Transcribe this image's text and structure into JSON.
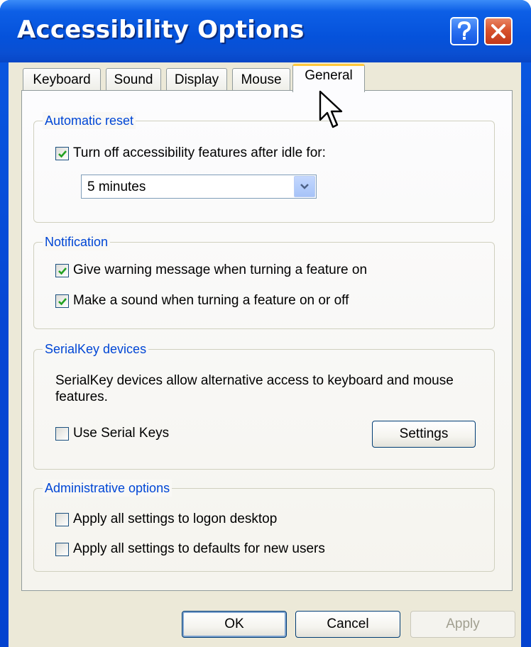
{
  "window": {
    "title": "Accessibility Options",
    "help_icon": "question-mark-icon",
    "close_icon": "close-x-icon"
  },
  "tabs": [
    {
      "label": "Keyboard",
      "active": false
    },
    {
      "label": "Sound",
      "active": false
    },
    {
      "label": "Display",
      "active": false
    },
    {
      "label": "Mouse",
      "active": false
    },
    {
      "label": "General",
      "active": true
    }
  ],
  "automatic_reset": {
    "label": "Automatic reset",
    "checkbox_label": "Turn off accessibility features after idle for:",
    "checked": true,
    "selected_value": "5 minutes"
  },
  "notification": {
    "label": "Notification",
    "items": [
      {
        "label": "Give warning message when turning a feature on",
        "checked": true
      },
      {
        "label": "Make a sound when turning a feature on or off",
        "checked": true
      }
    ]
  },
  "serialkey": {
    "label": "SerialKey devices",
    "description": "SerialKey devices allow alternative access to keyboard and mouse features.",
    "checkbox_label": "Use Serial Keys",
    "checked": false,
    "settings_label": "Settings"
  },
  "admin": {
    "label": "Administrative options",
    "items": [
      {
        "label": "Apply all settings to logon desktop",
        "checked": false
      },
      {
        "label": "Apply all settings to defaults for new users",
        "checked": false
      }
    ]
  },
  "buttons": {
    "ok": "OK",
    "cancel": "Cancel",
    "apply": "Apply"
  },
  "colors": {
    "title_bar": "#0a5ae2",
    "group_label": "#0046d5",
    "checkmark": "#21a121"
  }
}
